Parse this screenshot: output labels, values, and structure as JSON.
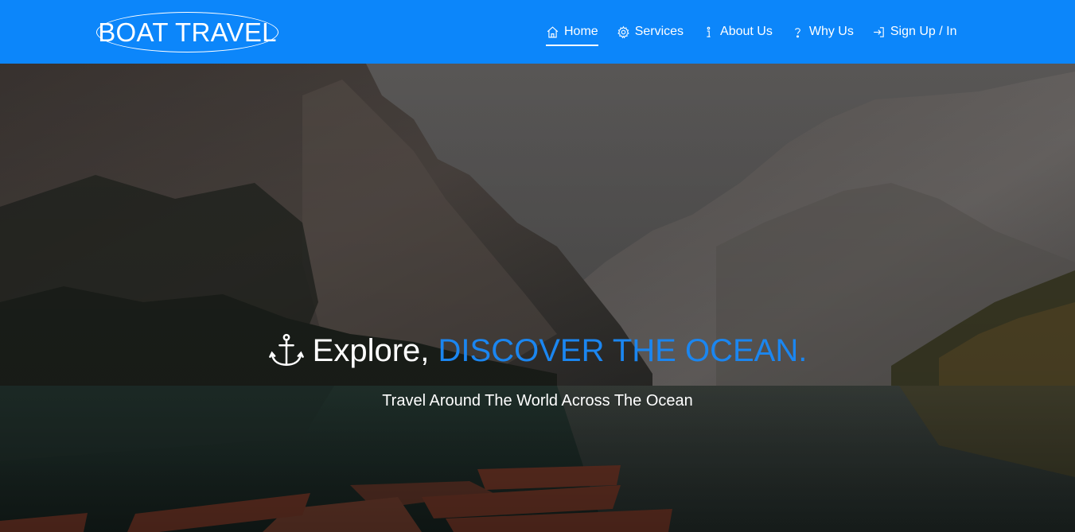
{
  "brand": {
    "name": "BOAT TRAVEL"
  },
  "nav": {
    "items": [
      {
        "label": "Home",
        "icon": "home-icon",
        "active": true
      },
      {
        "label": "Services",
        "icon": "gear-icon"
      },
      {
        "label": "About Us",
        "icon": "info-icon"
      },
      {
        "label": "Why Us",
        "icon": "question-icon"
      },
      {
        "label": "Sign Up / In",
        "icon": "sign-in-icon"
      }
    ]
  },
  "hero": {
    "headline_prefix": "Explore,",
    "headline_accent": "DISCOVER THE OCEAN.",
    "subtitle": "Travel Around The World Across The Ocean",
    "icon": "anchor-icon"
  },
  "colors": {
    "navbar": "#0c86fa",
    "accent": "#1b86f0",
    "text": "#ffffff"
  }
}
